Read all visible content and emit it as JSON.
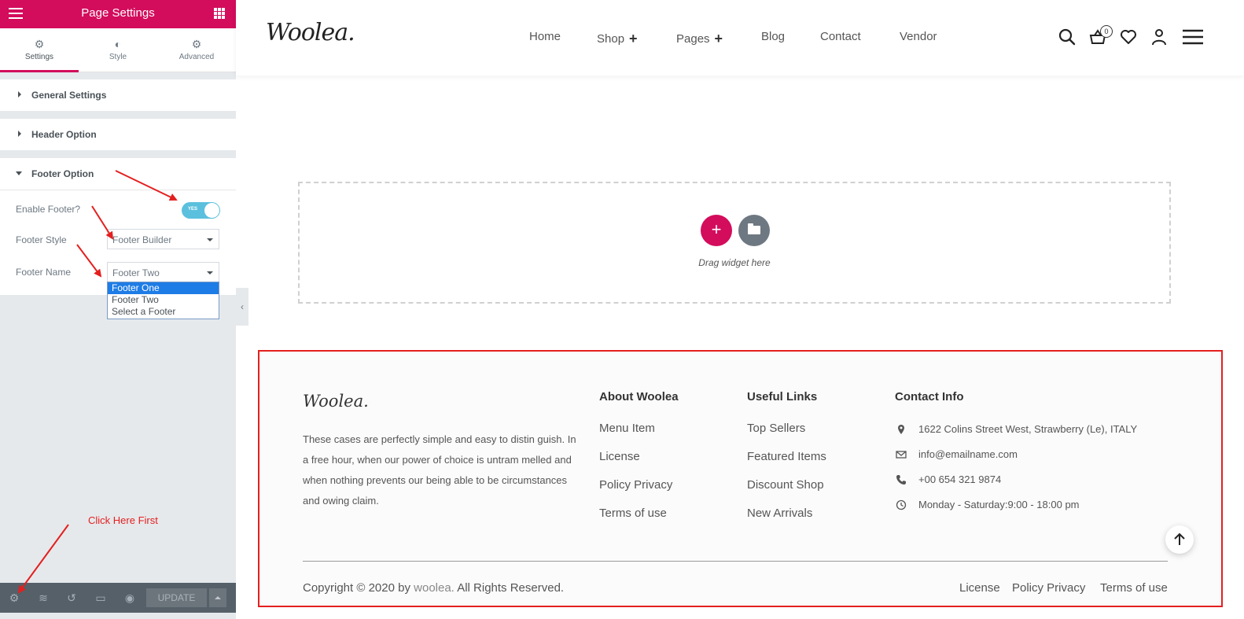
{
  "panel": {
    "title": "Page Settings",
    "tabs": [
      {
        "label": "Settings",
        "icon": "gear-icon"
      },
      {
        "label": "Style",
        "icon": "half-circle-icon"
      },
      {
        "label": "Advanced",
        "icon": "gear-icon"
      }
    ],
    "sections": {
      "general": "General Settings",
      "header": "Header Option",
      "footer": "Footer Option"
    },
    "controls": {
      "enable_footer_label": "Enable Footer?",
      "enable_footer_toggle": "YES",
      "footer_style_label": "Footer Style",
      "footer_style_value": "Footer Builder",
      "footer_name_label": "Footer Name",
      "footer_name_value": "Footer Two",
      "footer_name_options": [
        "Footer One",
        "Footer Two",
        "Select a Footer"
      ]
    },
    "note": "Click Here First",
    "update_label": "UPDATE",
    "accent": "#d30c5c"
  },
  "site": {
    "logo": "Woolea.",
    "nav": [
      "Home",
      "Shop",
      "Pages",
      "Blog",
      "Contact",
      "Vendor"
    ],
    "cart_count": "0",
    "dropzone_text": "Drag widget here"
  },
  "footer": {
    "logo": "Woolea.",
    "about": "These cases are perfectly simple and easy to distin guish. In a free hour, when our power of choice is untram melled and when nothing prevents our being able to be circumstances and owing claim.",
    "about_title": "About Woolea",
    "about_links": [
      "Menu Item",
      "License",
      "Policy Privacy",
      "Terms of use"
    ],
    "useful_title": "Useful Links",
    "useful_links": [
      "Top Sellers",
      "Featured Items",
      "Discount Shop",
      "New Arrivals"
    ],
    "contact_title": "Contact Info",
    "contact": {
      "address": "1622 Colins Street West, Strawberry (Le), ITALY",
      "email": "info@emailname.com",
      "phone": "+00 654 321 9874",
      "hours": "Monday - Saturday:9:00 - 18:00 pm"
    },
    "copyright_prefix": "Copyright © 2020 by",
    "copyright_brand": "woolea.",
    "copyright_suffix": "All Rights Reserved.",
    "bottom_links": [
      "License",
      "Policy Privacy",
      "Terms of use"
    ]
  }
}
